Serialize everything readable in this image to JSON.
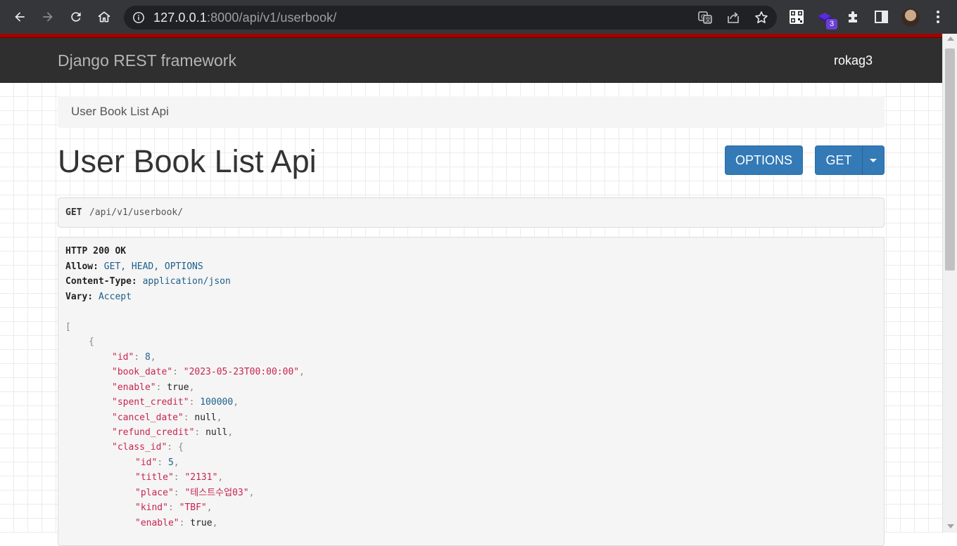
{
  "browser": {
    "url_host": "127.0.0.1",
    "url_rest": ":8000/api/v1/userbook/",
    "extension_badge": "3",
    "icons": [
      "back-icon",
      "forward-icon",
      "reload-icon",
      "home-icon",
      "info-icon",
      "translate-icon",
      "share-icon",
      "star-icon",
      "qr-code-icon",
      "extension-purple-icon",
      "puzzle-icon",
      "sidebar-icon",
      "avatar",
      "menu-dots-icon"
    ]
  },
  "navbar": {
    "brand": "Django REST framework",
    "user": "rokag3"
  },
  "breadcrumb": {
    "label": "User Book List Api"
  },
  "page": {
    "title": "User Book List Api",
    "options_label": "OPTIONS",
    "get_label": "GET"
  },
  "request": {
    "method": "GET",
    "path": "/api/v1/userbook/"
  },
  "response": {
    "status": "HTTP 200 OK",
    "headers": [
      {
        "key": "Allow:",
        "value": "GET, HEAD, OPTIONS"
      },
      {
        "key": "Content-Type:",
        "value": "application/json"
      },
      {
        "key": "Vary:",
        "value": "Accept"
      }
    ],
    "body": {
      "open_bracket": "[",
      "open_brace": "{",
      "fields": [
        {
          "key": "\"id\"",
          "value": "8",
          "type": "num"
        },
        {
          "key": "\"book_date\"",
          "value": "\"2023-05-23T00:00:00\"",
          "type": "str"
        },
        {
          "key": "\"enable\"",
          "value": "true",
          "type": "lit"
        },
        {
          "key": "\"spent_credit\"",
          "value": "100000",
          "type": "num"
        },
        {
          "key": "\"cancel_date\"",
          "value": "null",
          "type": "lit"
        },
        {
          "key": "\"refund_credit\"",
          "value": "null",
          "type": "lit"
        },
        {
          "key": "\"class_id\"",
          "value": "{",
          "type": "pun"
        }
      ],
      "class_fields": [
        {
          "key": "\"id\"",
          "value": "5",
          "type": "num"
        },
        {
          "key": "\"title\"",
          "value": "\"2131\"",
          "type": "str"
        },
        {
          "key": "\"place\"",
          "value": "\"테스트수업03\"",
          "type": "str"
        },
        {
          "key": "\"kind\"",
          "value": "\"TBF\"",
          "type": "str"
        },
        {
          "key": "\"enable\"",
          "value": "true",
          "type": "lit"
        }
      ]
    }
  }
}
